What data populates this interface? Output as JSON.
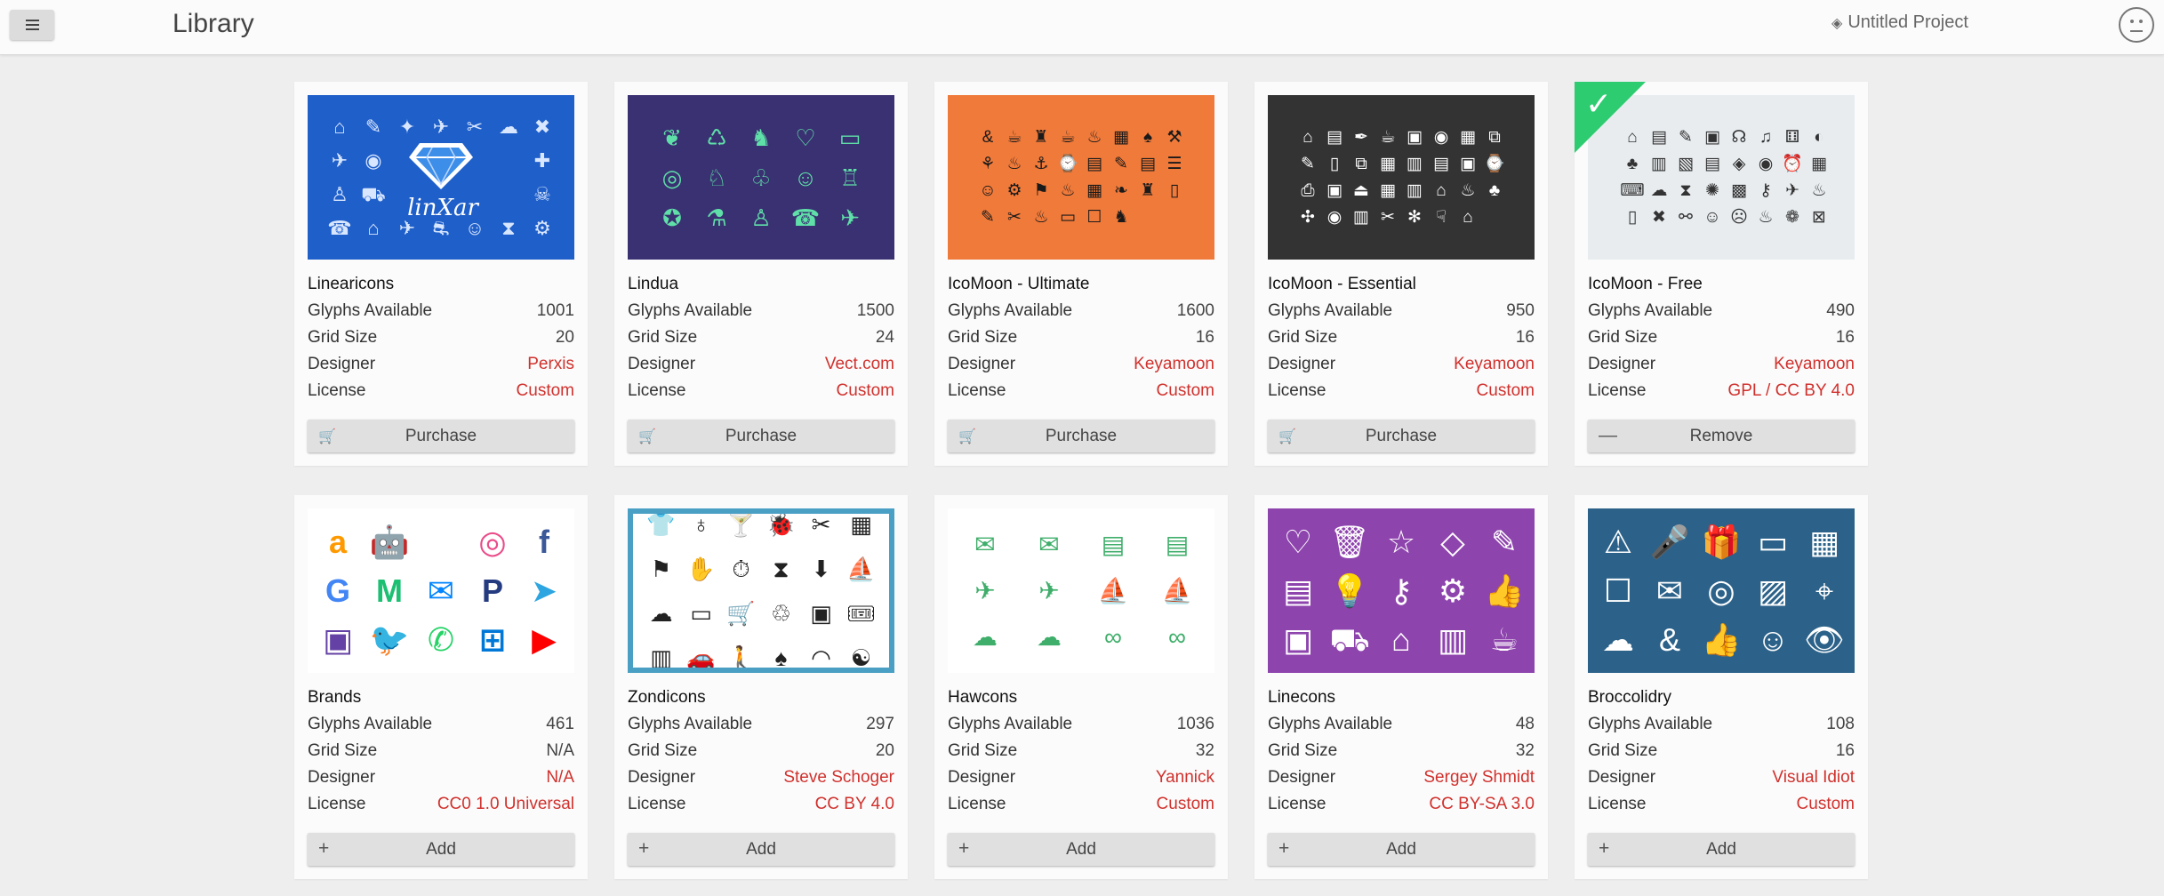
{
  "header": {
    "title": "Library",
    "project_name": "Untitled Project"
  },
  "field_labels": {
    "glyphs": "Glyphs Available",
    "grid": "Grid Size",
    "designer": "Designer",
    "license": "License"
  },
  "colors": {
    "accent_red": "#d0312d",
    "check_green": "#2ecc71"
  },
  "libraries": [
    {
      "name": "Linearicons",
      "glyphs": "1001",
      "grid": "20",
      "designer": "Perxis",
      "license": "Custom",
      "action": "Purchase",
      "action_icon": "cart-icon"
    },
    {
      "name": "Lindua",
      "glyphs": "1500",
      "grid": "24",
      "designer": "Vect.com",
      "license": "Custom",
      "action": "Purchase",
      "action_icon": "cart-icon"
    },
    {
      "name": "IcoMoon - Ultimate",
      "glyphs": "1600",
      "grid": "16",
      "designer": "Keyamoon",
      "license": "Custom",
      "action": "Purchase",
      "action_icon": "cart-icon"
    },
    {
      "name": "IcoMoon - Essential",
      "glyphs": "950",
      "grid": "16",
      "designer": "Keyamoon",
      "license": "Custom",
      "action": "Purchase",
      "action_icon": "cart-icon"
    },
    {
      "name": "IcoMoon - Free",
      "glyphs": "490",
      "grid": "16",
      "designer": "Keyamoon",
      "license": "GPL / CC BY 4.0",
      "action": "Remove",
      "action_icon": "minus-icon",
      "selected": true
    },
    {
      "name": "Brands",
      "glyphs": "461",
      "grid": "N/A",
      "designer": "N/A",
      "license": "CC0 1.0 Universal",
      "action": "Add",
      "action_icon": "plus-icon"
    },
    {
      "name": "Zondicons",
      "glyphs": "297",
      "grid": "20",
      "designer": "Steve Schoger",
      "license": "CC BY 4.0",
      "action": "Add",
      "action_icon": "plus-icon"
    },
    {
      "name": "Hawcons",
      "glyphs": "1036",
      "grid": "32",
      "designer": "Yannick",
      "license": "Custom",
      "action": "Add",
      "action_icon": "plus-icon"
    },
    {
      "name": "Linecons",
      "glyphs": "48",
      "grid": "32",
      "designer": "Sergey Shmidt",
      "license": "CC BY-SA 3.0",
      "action": "Add",
      "action_icon": "plus-icon"
    },
    {
      "name": "Broccolidry",
      "glyphs": "108",
      "grid": "16",
      "designer": "Visual Idiot",
      "license": "Custom",
      "action": "Add",
      "action_icon": "plus-icon"
    }
  ],
  "previews": [
    {
      "bg": "#1f5fc9",
      "fg": "#d8e6ff",
      "logo_text": "linXar",
      "icons": [
        "⌂",
        "✎",
        "✦",
        "✈",
        "✂",
        "☁",
        "✖",
        "✈",
        "◉",
        "",
        "",
        "",
        "",
        "✚",
        "♙",
        "⛟",
        "",
        "",
        "",
        "⚗",
        "☠",
        "☎",
        "⌂",
        "✈",
        "⛐",
        "☺",
        "⧗",
        "⚙"
      ]
    },
    {
      "bg": "#3a3172",
      "fg": "#5fe0a8",
      "icons": [
        "❦",
        "♺",
        "♞",
        "♡",
        "▭",
        "◎",
        "♘",
        "♧",
        "☺",
        "♖",
        "✪",
        "⚗",
        "♙",
        "☎",
        "✈"
      ]
    },
    {
      "bg": "#f07a3a",
      "fg": "#1a1a1a",
      "icons": [
        "&",
        "☕",
        "♜",
        "☕",
        "♨",
        "▦",
        "♠",
        "⚒",
        "⚘",
        "♨",
        "⚓",
        "⌚",
        "▤",
        "✎",
        "▤",
        "☰",
        "☺",
        "⚙",
        "⚑",
        "♨",
        "▦",
        "❧",
        "♜",
        "▯",
        "✎",
        "✂",
        "♨",
        "▭",
        "☐",
        "♞"
      ]
    },
    {
      "bg": "#333333",
      "fg": "#ffffff",
      "icons": [
        "⌂",
        "▤",
        "✒",
        "☕",
        "▣",
        "◉",
        "▦",
        "⧉",
        "✎",
        "▯",
        "⧉",
        "▦",
        "▥",
        "▤",
        "▣",
        "⌚",
        "⎙",
        "▣",
        "⏏",
        "▦",
        "▥",
        "⌂",
        "♨",
        "♣",
        "✣",
        "◉",
        "▥",
        "✂",
        "✻",
        "☟",
        "⌂"
      ]
    },
    {
      "bg": "#e8ecef",
      "fg": "#333333",
      "icons": [
        "⌂",
        "▤",
        "✎",
        "▣",
        "☊",
        "♫",
        "⚅",
        "◐",
        "♣",
        "▥",
        "▧",
        "▤",
        "◈",
        "◉",
        "⏰",
        "▦",
        "⌨",
        "☁",
        "⧗",
        "✺",
        "▩",
        "⚷",
        "✈",
        "♨",
        "▯",
        "✖",
        "⚯",
        "☺",
        "☹",
        "♨",
        "❁",
        "⊠"
      ]
    },
    {
      "bg": "#ffffff",
      "fg": "#555555",
      "icons": [
        {
          "g": "a",
          "c": "#ff9900"
        },
        {
          "g": "🤖",
          "c": "#a4c639"
        },
        {
          "g": "",
          "c": "#999999"
        },
        {
          "g": "◎",
          "c": "#ea4c89"
        },
        {
          "g": "f",
          "c": "#3b5998"
        },
        {
          "g": "G",
          "c": "#4285f4"
        },
        {
          "g": "M",
          "c": "#1dbf73"
        },
        {
          "g": "✉",
          "c": "#0084ff"
        },
        {
          "g": "P",
          "c": "#253b80"
        },
        {
          "g": "➤",
          "c": "#2ca5e0"
        },
        {
          "g": "▣",
          "c": "#6441a5"
        },
        {
          "g": "🐦",
          "c": "#1da1f2"
        },
        {
          "g": "✆",
          "c": "#25d366"
        },
        {
          "g": "⊞",
          "c": "#0078d7"
        },
        {
          "g": "▶",
          "c": "#ff0000"
        }
      ]
    },
    {
      "bg": "#ffffff",
      "fg": "#222222",
      "border": "#4a9fc4",
      "icons": [
        "👕",
        "♁",
        "🍸",
        "🐞",
        "✂",
        "▦",
        "⚑",
        "✋",
        "⏱",
        "⧗",
        "⬇",
        "⛵",
        "☁",
        "▭",
        "🛒",
        "♲",
        "▣",
        "🎟",
        "▥",
        "🚗",
        "🚶",
        "♠",
        "◠",
        "☯"
      ]
    },
    {
      "bg": "#ffffff",
      "fg": "#3fae6a",
      "icons": [
        "✉",
        "✉",
        "▤",
        "▤",
        "✈",
        "✈",
        "⛵",
        "⛵",
        "☁",
        "☁",
        "∞",
        "∞"
      ]
    },
    {
      "bg": "#8e44ad",
      "fg": "#ffffff",
      "icons": [
        "♡",
        "🗑",
        "☆",
        "◇",
        "✎",
        "▤",
        "💡",
        "⚷",
        "⚙",
        "👍",
        "▣",
        "⛟",
        "⌂",
        "▥",
        "☕"
      ]
    },
    {
      "bg": "#2c6289",
      "fg": "#ffffff",
      "icons": [
        "⚠",
        "🎤",
        "🎁",
        "▭",
        "▦",
        "☐",
        "✉",
        "◎",
        "▨",
        "⌖",
        "☁",
        "&",
        "👍",
        "☺",
        "👁"
      ]
    }
  ]
}
